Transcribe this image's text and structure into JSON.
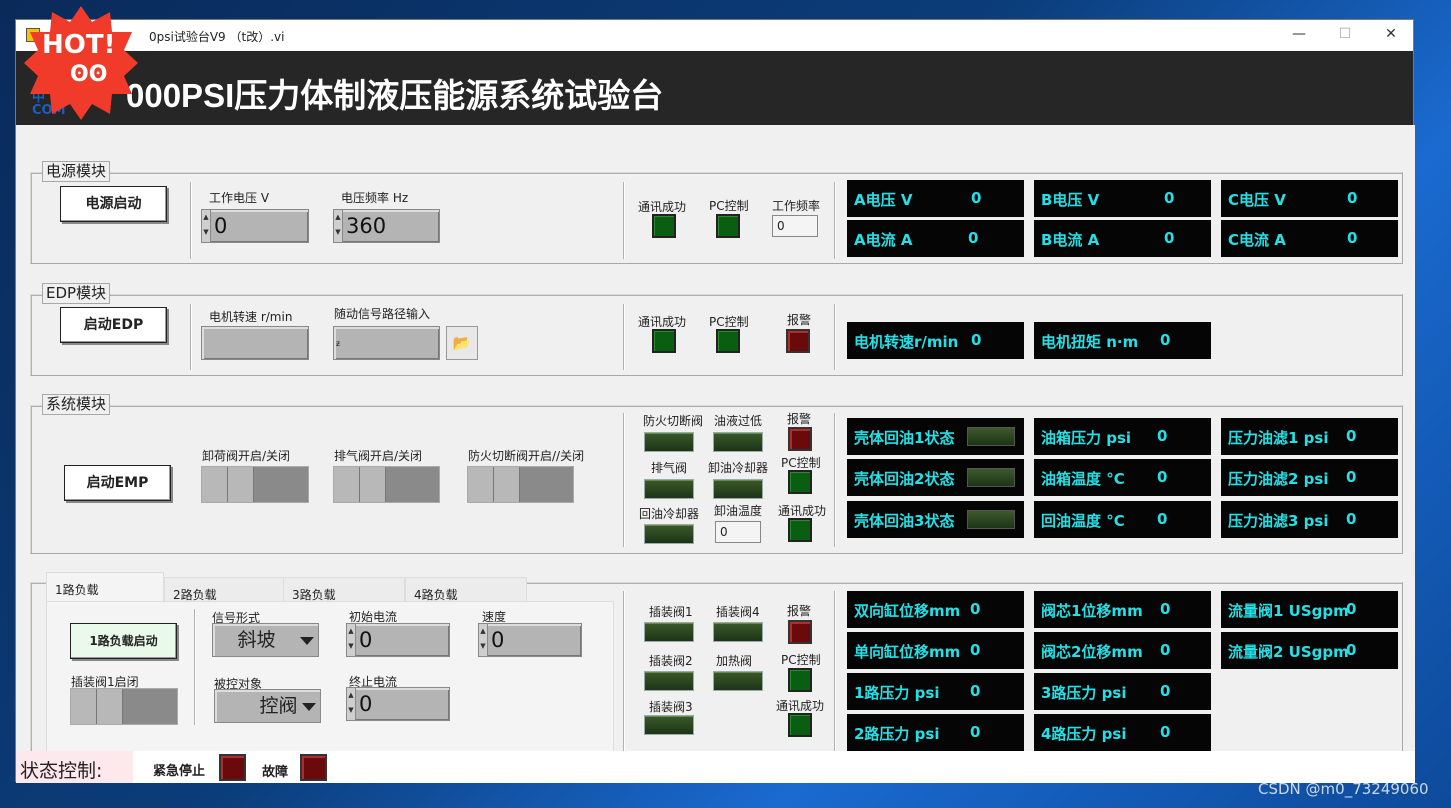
{
  "window": {
    "title": "0psi试验台V9 （t改）.vi",
    "minimize": "—",
    "maximize": "☐",
    "close": "✕"
  },
  "header": {
    "title": "000PSI压力体制液压能源系统试验台",
    "logo_lines": [
      "中",
      "COM"
    ]
  },
  "badge": {
    "text": "HOT!",
    "face": "ʘʘ"
  },
  "power": {
    "legend": "电源模块",
    "start_button": "电源启动",
    "voltage_label": "工作电压 V",
    "voltage_value": "0",
    "freq_label": "电压频率 Hz",
    "freq_value": "360",
    "comm_ok": "通讯成功",
    "pc_ctrl": "PC控制",
    "work_freq": "工作频率",
    "work_freq_value": "0",
    "displays": [
      {
        "k": "A电压  V",
        "v": "0"
      },
      {
        "k": "B电压 V",
        "v": "0"
      },
      {
        "k": "C电压 V",
        "v": "0"
      },
      {
        "k": "A电流  A",
        "v": "0"
      },
      {
        "k": "B电流 A",
        "v": "0"
      },
      {
        "k": "C电流 A",
        "v": "0"
      }
    ]
  },
  "edp": {
    "legend": "EDP模块",
    "start_button": "启动EDP",
    "speed_label": "电机转速 r/min",
    "path_label": "随动信号路径输入",
    "comm_ok": "通讯成功",
    "pc_ctrl": "PC控制",
    "alarm": "报警",
    "displays": [
      {
        "k": "电机转速r/min",
        "v": "0"
      },
      {
        "k": "电机扭矩 n·m",
        "v": "0"
      }
    ]
  },
  "system": {
    "legend": "系统模块",
    "start_button": "启动EMP",
    "unload": "卸荷阀开启/关闭",
    "exhaust": "排气阀开启/关闭",
    "fire": "防火切断阀开启//关闭",
    "fire_valve": "防火切断阀",
    "low_oil": "油液过低",
    "alarm": "报警",
    "vent": "排气阀",
    "unload_cooler": "卸油冷却器",
    "pc_ctrl": "PC控制",
    "return_cooler": "回油冷却器",
    "unload_temp": "卸油温度",
    "unload_temp_value": "0",
    "comm_ok": "通讯成功",
    "displays": [
      {
        "k": "壳体回油1状态",
        "v": ""
      },
      {
        "k": "油箱压力   psi",
        "v": "0"
      },
      {
        "k": "压力油滤1 psi",
        "v": "0"
      },
      {
        "k": "壳体回油2状态",
        "v": ""
      },
      {
        "k": "油箱温度    °C",
        "v": "0"
      },
      {
        "k": "压力油滤2 psi",
        "v": "0"
      },
      {
        "k": "壳体回油3状态",
        "v": ""
      },
      {
        "k": "回油温度    °C",
        "v": "0"
      },
      {
        "k": "压力油滤3 psi",
        "v": "0"
      }
    ]
  },
  "load": {
    "tabs": [
      "1路负载",
      "2路负载",
      "3路负载",
      "4路负载"
    ],
    "start_button": "1路负载启动",
    "signal_label": "信号形式",
    "signal_value": "斜坡",
    "init_current_label": "初始电流",
    "init_current_value": "0",
    "speed_label": "速度",
    "speed_value": "0",
    "valve1_label": "插装阀1启闭",
    "controlled_label": "被控对象",
    "controlled_value": "控阀",
    "end_current_label": "终止电流",
    "end_current_value": "0",
    "cv1": "插装阀1",
    "cv4": "插装阀4",
    "alarm": "报警",
    "cv2": "插装阀2",
    "heater": "加热阀",
    "pc_ctrl": "PC控制",
    "cv3": "插装阀3",
    "comm_ok": "通讯成功",
    "displays": [
      {
        "k": "双向缸位移mm",
        "v": "0"
      },
      {
        "k": "阀芯1位移mm",
        "v": "0"
      },
      {
        "k": "流量阀1 USgpm",
        "v": "0"
      },
      {
        "k": "单向缸位移mm",
        "v": "0"
      },
      {
        "k": "阀芯2位移mm",
        "v": "0"
      },
      {
        "k": "流量阀2 USgpm",
        "v": "0"
      },
      {
        "k": "1路压力    psi",
        "v": "0"
      },
      {
        "k": "3路压力    psi",
        "v": "0"
      },
      {
        "k": "2路压力    psi",
        "v": "0"
      },
      {
        "k": "4路压力    psi",
        "v": "0"
      }
    ]
  },
  "status": {
    "label": "状态控制:",
    "estop": "紧急停止",
    "fault": "故障"
  },
  "watermark": "CSDN @m0_73249060"
}
